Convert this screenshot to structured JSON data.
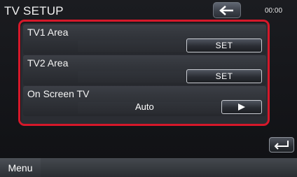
{
  "header": {
    "title": "TV SETUP",
    "clock": "00:00"
  },
  "rows": [
    {
      "label": "TV1 Area",
      "button_label": "SET"
    },
    {
      "label": "TV2 Area",
      "button_label": "SET"
    },
    {
      "label": "On Screen TV",
      "value": "Auto"
    }
  ],
  "footer": {
    "menu_label": "Menu"
  },
  "colors": {
    "highlight": "#d6182a",
    "background": "#16171b"
  },
  "icons": [
    "back-arrow-icon",
    "play-icon",
    "return-icon"
  ]
}
